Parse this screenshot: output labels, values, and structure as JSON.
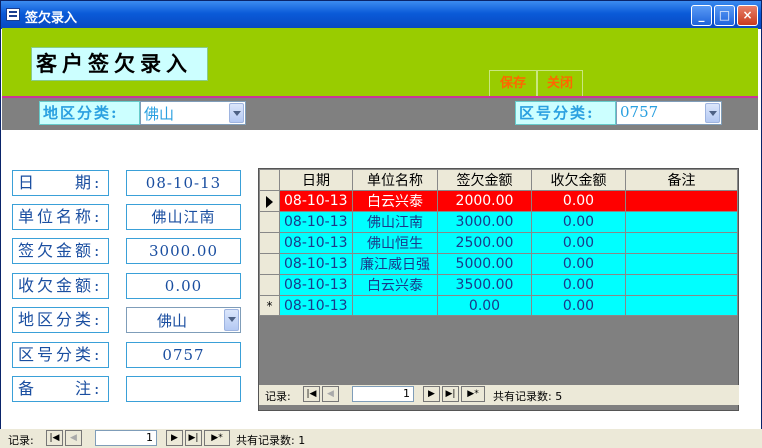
{
  "window": {
    "title": "签欠录入"
  },
  "header": {
    "form_title": "客户签欠录入",
    "save_button": "保存",
    "close_button": "关闭"
  },
  "filters": {
    "region_label": "地区分类:",
    "region_value": "佛山",
    "code_label": "区号分类:",
    "code_value": "0757"
  },
  "form": {
    "date_label": "日　　期:",
    "date_value": "08-10-13",
    "unit_label": "单位名称:",
    "unit_value": "佛山江南",
    "sign_label": "签欠金额:",
    "sign_value": "3000.00",
    "recv_label": "收欠金额:",
    "recv_value": "0.00",
    "region_label": "地区分类:",
    "region_value": "佛山",
    "code_label": "区号分类:",
    "code_value": "0757",
    "memo_label": "备　　注:",
    "memo_value": ""
  },
  "grid": {
    "columns": [
      "日期",
      "单位名称",
      "签欠金额",
      "收欠金额",
      "备注"
    ],
    "rows": [
      {
        "date": "08-10-13",
        "unit": "白云兴泰",
        "sign": "2000.00",
        "recv": "0.00",
        "memo": ""
      },
      {
        "date": "08-10-13",
        "unit": "佛山江南",
        "sign": "3000.00",
        "recv": "0.00",
        "memo": ""
      },
      {
        "date": "08-10-13",
        "unit": "佛山恒生",
        "sign": "2500.00",
        "recv": "0.00",
        "memo": ""
      },
      {
        "date": "08-10-13",
        "unit": "廉江威日强",
        "sign": "5000.00",
        "recv": "0.00",
        "memo": ""
      },
      {
        "date": "08-10-13",
        "unit": "白云兴泰",
        "sign": "3500.00",
        "recv": "0.00",
        "memo": ""
      }
    ],
    "new_row": {
      "marker": "*",
      "date": "08-10-13",
      "sign": "0.00",
      "recv": "0.00"
    },
    "navigation": {
      "label": "记录:",
      "current": "1",
      "total_text": "共有记录数: 5"
    }
  },
  "form_navigation": {
    "label": "记录:",
    "current": "1",
    "total_text": "共有记录数: 1"
  }
}
